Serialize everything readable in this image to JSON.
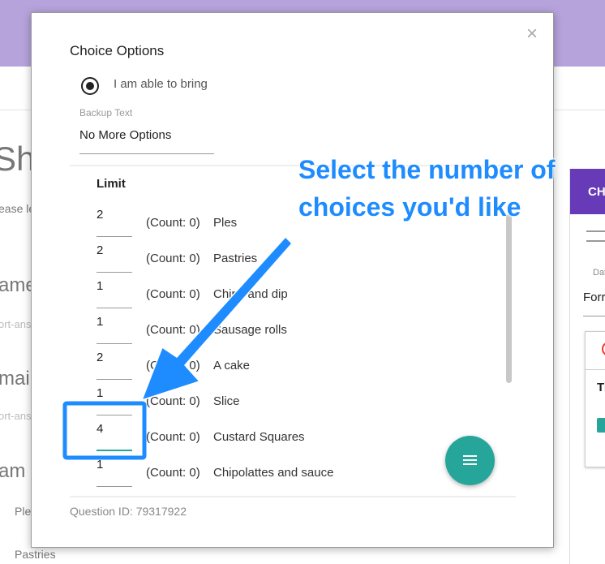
{
  "background": {
    "title_frag": "Sha",
    "desc_frag": "ease le",
    "name_frag": "ame",
    "short_frag1": "ort-ans",
    "email_frag": "mail",
    "short_frag2": "ort-ans",
    "able_frag": "am a",
    "opt1": "Ple",
    "opt2": "Pastries"
  },
  "right_panel": {
    "tab_frag": "CH",
    "label_frag": "Dat",
    "value_frag": "Forr",
    "title_frag": "Ti"
  },
  "dialog": {
    "title": "Choice Options",
    "radio_label": "I am able to bring",
    "backup_label": "Backup Text",
    "backup_value": "No More Options",
    "limit_header": "Limit",
    "question_id": "Question ID: 79317922",
    "close_icon": "×",
    "rows": [
      {
        "limit": "2",
        "count": "(Count: 0)",
        "name": "Ples"
      },
      {
        "limit": "2",
        "count": "(Count: 0)",
        "name": "Pastries"
      },
      {
        "limit": "1",
        "count": "(Count: 0)",
        "name": "Chips and dip"
      },
      {
        "limit": "1",
        "count": "(Count: 0)",
        "name": "Sausage rolls"
      },
      {
        "limit": "2",
        "count": "(Count: 0)",
        "name": "A cake"
      },
      {
        "limit": "1",
        "count": "(Count: 0)",
        "name": "Slice"
      },
      {
        "limit": "4",
        "count": "(Count: 0)",
        "name": "Custard Squares"
      },
      {
        "limit": "1",
        "count": "(Count: 0)",
        "name": "Chipolattes and sauce"
      }
    ]
  },
  "callout": {
    "line1": "Select the number of",
    "line2": "choices you'd like"
  },
  "colors": {
    "accent": "#26a69a",
    "callout": "#1e8cff",
    "header": "#b7a3dc",
    "tab": "#673ab7"
  }
}
